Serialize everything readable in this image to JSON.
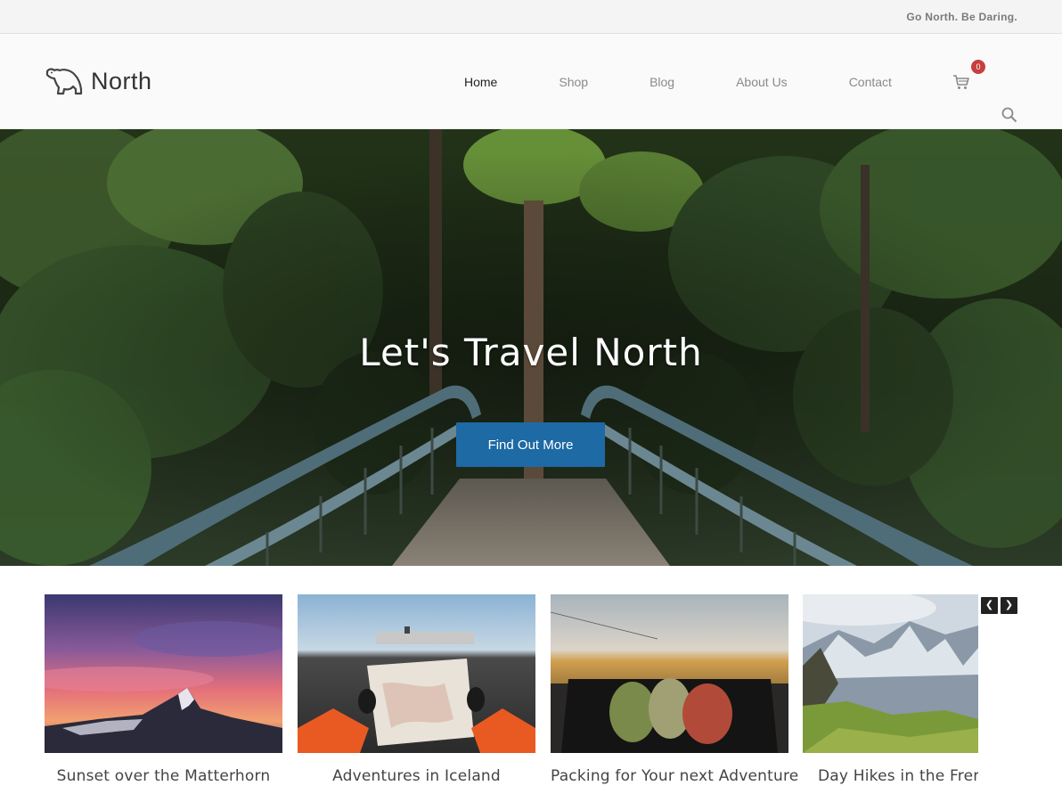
{
  "topbar": {
    "tagline": "Go North. Be Daring."
  },
  "header": {
    "logo_text": "North",
    "logo_icon": "polar-bear-icon",
    "nav": [
      {
        "label": "Home",
        "active": true
      },
      {
        "label": "Shop",
        "active": false
      },
      {
        "label": "Blog",
        "active": false
      },
      {
        "label": "About Us",
        "active": false
      },
      {
        "label": "Contact",
        "active": false
      }
    ],
    "cart_count": "0",
    "cart_icon": "cart-icon",
    "search_icon": "search-icon"
  },
  "hero": {
    "title": "Let's Travel North",
    "button_label": "Find Out More",
    "button_color": "#1d6aa5"
  },
  "carousel": {
    "items": [
      {
        "title": "Sunset over the Matterhorn"
      },
      {
        "title": "Adventures in Iceland"
      },
      {
        "title": "Packing for Your next Adventure"
      },
      {
        "title": "Day Hikes in the French Alps"
      }
    ],
    "prev_icon": "chevron-left-icon",
    "next_icon": "chevron-right-icon"
  },
  "colors": {
    "badge": "#c93e3e",
    "accent": "#1d6aa5"
  }
}
